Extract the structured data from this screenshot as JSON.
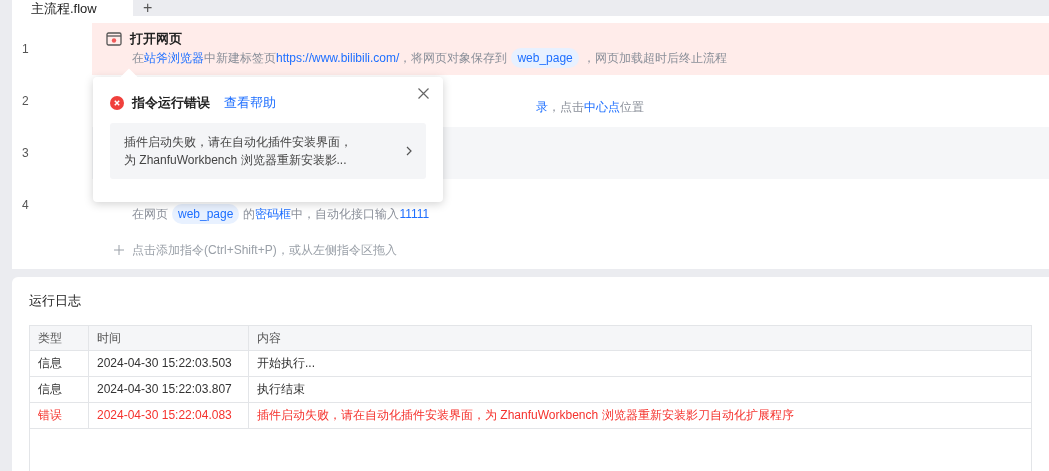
{
  "tabs": [
    {
      "label": "主流程.flow",
      "selected": true
    }
  ],
  "add_tab": "+",
  "steps": [
    {
      "number": "1",
      "kind": "error",
      "title": "打开网页",
      "desc": [
        {
          "kind": "text",
          "text": "在"
        },
        {
          "kind": "link",
          "text": "站斧浏览器"
        },
        {
          "kind": "text",
          "text": "中新建标签页"
        },
        {
          "kind": "link",
          "text": "https://www.bilibili.com/"
        },
        {
          "kind": "text",
          "text": "，将网页对象保存到"
        },
        {
          "kind": "var",
          "text": "web_page"
        },
        {
          "kind": "text",
          "text": "，网页加载超时后终止流程"
        }
      ]
    },
    {
      "number": "2",
      "kind": "covered",
      "desc": [
        {
          "kind": "link",
          "text": "录"
        },
        {
          "kind": "text",
          "text": "，点击"
        },
        {
          "kind": "link",
          "text": "中心点"
        },
        {
          "kind": "text",
          "text": "位置"
        }
      ]
    },
    {
      "number": "3",
      "kind": "selected"
    },
    {
      "number": "4",
      "kind": "covered-title",
      "desc": [
        {
          "kind": "text",
          "text": "在网页"
        },
        {
          "kind": "var",
          "text": "web_page"
        },
        {
          "kind": "text",
          "text": "的"
        },
        {
          "kind": "link",
          "text": "密码框"
        },
        {
          "kind": "text",
          "text": "中，自动化接口输入"
        },
        {
          "kind": "link",
          "text": "11111"
        }
      ]
    }
  ],
  "add_hint": "点击添加指令(Ctrl+Shift+P)，或从左侧指令区拖入",
  "error_popup": {
    "title": "指令运行错误",
    "help_link": "查看帮助",
    "message_lines": [
      "插件启动失败，请在自动化插件安装界面，",
      "为 ZhanfuWorkbench 浏览器重新安装影..."
    ]
  },
  "log": {
    "title": "运行日志",
    "columns": [
      "类型",
      "时间",
      "内容"
    ],
    "rows": [
      {
        "kind": "info",
        "cells": [
          "信息",
          "2024-04-30 15:22:03.503",
          "开始执行..."
        ]
      },
      {
        "kind": "info",
        "cells": [
          "信息",
          "2024-04-30 15:22:03.807",
          "执行结束"
        ]
      },
      {
        "kind": "error",
        "cells": [
          "错误",
          "2024-04-30 15:22:04.083",
          "插件启动失败，请在自动化插件安装界面，为 ZhanfuWorkbench 浏览器重新安装影刀自动化扩展程序"
        ]
      }
    ]
  }
}
